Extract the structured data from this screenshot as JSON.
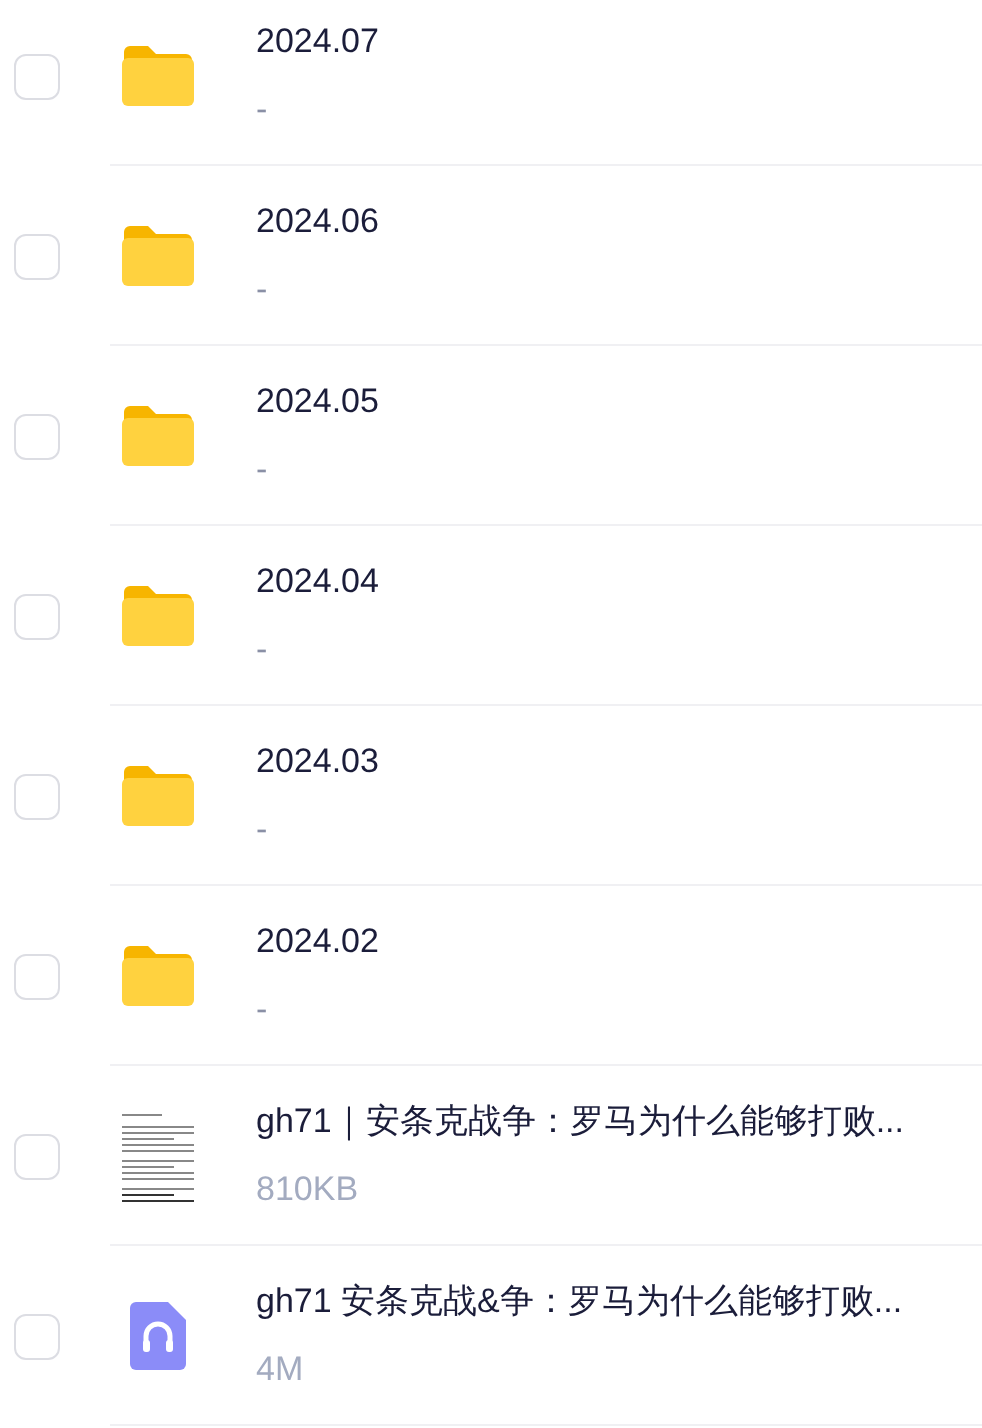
{
  "files": [
    {
      "kind": "folder",
      "name": "2024.07",
      "meta": "-",
      "checked": false
    },
    {
      "kind": "folder",
      "name": "2024.06",
      "meta": "-",
      "checked": false
    },
    {
      "kind": "folder",
      "name": "2024.05",
      "meta": "-",
      "checked": false
    },
    {
      "kind": "folder",
      "name": "2024.04",
      "meta": "-",
      "checked": false
    },
    {
      "kind": "folder",
      "name": "2024.03",
      "meta": "-",
      "checked": false
    },
    {
      "kind": "folder",
      "name": "2024.02",
      "meta": "-",
      "checked": false
    },
    {
      "kind": "document",
      "name": "gh71｜安条克战争：罗马为什么能够打败...",
      "meta": "810KB",
      "checked": false
    },
    {
      "kind": "audio",
      "name": "gh71 安条克战&争：罗马为什么能够打败...",
      "meta": "4M",
      "checked": false
    }
  ]
}
